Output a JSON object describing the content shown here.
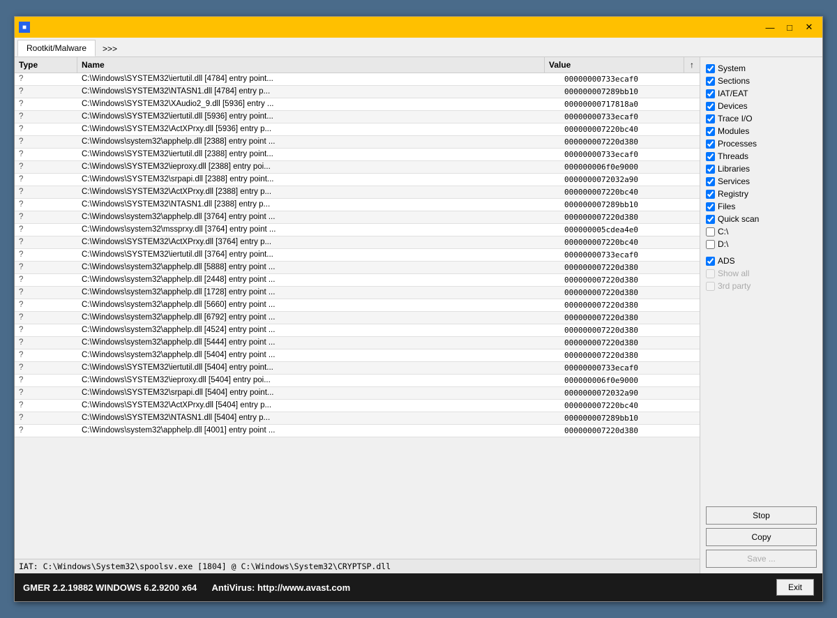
{
  "window": {
    "icon": "■",
    "minimize": "—",
    "maximize": "□",
    "close": "✕"
  },
  "tabs": [
    {
      "label": "Rootkit/Malware",
      "active": true
    },
    {
      "label": ">>>",
      "active": false
    }
  ],
  "table": {
    "columns": [
      {
        "label": "Type",
        "key": "type"
      },
      {
        "label": "Name",
        "key": "name"
      },
      {
        "label": "Value",
        "key": "value"
      },
      {
        "label": "↑",
        "key": "sort"
      }
    ],
    "rows": [
      {
        "type": "?",
        "name": "C:\\Windows\\SYSTEM32\\iertutil.dll [4784] entry point...",
        "value": "00000000733ecaf0"
      },
      {
        "type": "?",
        "name": "C:\\Windows\\SYSTEM32\\NTASN1.dll [4784] entry p...",
        "value": "000000007289bb10"
      },
      {
        "type": "?",
        "name": "C:\\Windows\\SYSTEM32\\XAudio2_9.dll [5936] entry ...",
        "value": "00000000717818a0"
      },
      {
        "type": "?",
        "name": "C:\\Windows\\SYSTEM32\\iertutil.dll [5936] entry point...",
        "value": "00000000733ecaf0"
      },
      {
        "type": "?",
        "name": "C:\\Windows\\SYSTEM32\\ActXPrxy.dll [5936] entry p...",
        "value": "000000007220bc40"
      },
      {
        "type": "?",
        "name": "C:\\Windows\\system32\\apphelp.dll [2388] entry point ...",
        "value": "000000007220d380"
      },
      {
        "type": "?",
        "name": "C:\\Windows\\SYSTEM32\\iertutil.dll [2388] entry point...",
        "value": "00000000733ecaf0"
      },
      {
        "type": "?",
        "name": "C:\\Windows\\SYSTEM32\\ieproxy.dll [2388] entry poi...",
        "value": "000000006f0e9000"
      },
      {
        "type": "?",
        "name": "C:\\Windows\\SYSTEM32\\srpapi.dll [2388] entry point...",
        "value": "0000000072032a90"
      },
      {
        "type": "?",
        "name": "C:\\Windows\\SYSTEM32\\ActXPrxy.dll [2388] entry p...",
        "value": "000000007220bc40"
      },
      {
        "type": "?",
        "name": "C:\\Windows\\SYSTEM32\\NTASN1.dll [2388] entry p...",
        "value": "000000007289bb10"
      },
      {
        "type": "?",
        "name": "C:\\Windows\\system32\\apphelp.dll [3764] entry point ...",
        "value": "000000007220d380"
      },
      {
        "type": "?",
        "name": "C:\\Windows\\system32\\mssprxy.dll [3764] entry point ...",
        "value": "000000005cdea4e0"
      },
      {
        "type": "?",
        "name": "C:\\Windows\\SYSTEM32\\ActXPrxy.dll [3764] entry p...",
        "value": "000000007220bc40"
      },
      {
        "type": "?",
        "name": "C:\\Windows\\SYSTEM32\\iertutil.dll [3764] entry point...",
        "value": "00000000733ecaf0"
      },
      {
        "type": "?",
        "name": "C:\\Windows\\system32\\apphelp.dll [5888] entry point ...",
        "value": "000000007220d380"
      },
      {
        "type": "?",
        "name": "C:\\Windows\\system32\\apphelp.dll [2448] entry point ...",
        "value": "000000007220d380"
      },
      {
        "type": "?",
        "name": "C:\\Windows\\system32\\apphelp.dll [1728] entry point ...",
        "value": "000000007220d380"
      },
      {
        "type": "?",
        "name": "C:\\Windows\\system32\\apphelp.dll [5660] entry point ...",
        "value": "000000007220d380"
      },
      {
        "type": "?",
        "name": "C:\\Windows\\system32\\apphelp.dll [6792] entry point ...",
        "value": "000000007220d380"
      },
      {
        "type": "?",
        "name": "C:\\Windows\\system32\\apphelp.dll [4524] entry point ...",
        "value": "000000007220d380"
      },
      {
        "type": "?",
        "name": "C:\\Windows\\system32\\apphelp.dll [5444] entry point ...",
        "value": "000000007220d380"
      },
      {
        "type": "?",
        "name": "C:\\Windows\\system32\\apphelp.dll [5404] entry point ...",
        "value": "000000007220d380"
      },
      {
        "type": "?",
        "name": "C:\\Windows\\SYSTEM32\\iertutil.dll [5404] entry point...",
        "value": "00000000733ecaf0"
      },
      {
        "type": "?",
        "name": "C:\\Windows\\SYSTEM32\\ieproxy.dll [5404] entry poi...",
        "value": "000000006f0e9000"
      },
      {
        "type": "?",
        "name": "C:\\Windows\\SYSTEM32\\srpapi.dll [5404] entry point...",
        "value": "0000000072032a90"
      },
      {
        "type": "?",
        "name": "C:\\Windows\\SYSTEM32\\ActXPrxy.dll [5404] entry p...",
        "value": "000000007220bc40"
      },
      {
        "type": "?",
        "name": "C:\\Windows\\SYSTEM32\\NTASN1.dll [5404] entry p...",
        "value": "000000007289bb10"
      },
      {
        "type": "?",
        "name": "C:\\Windows\\system32\\apphelp.dll [4001] entry point ...",
        "value": "000000007220d380"
      }
    ]
  },
  "status_bar": {
    "text": "IAT: C:\\Windows\\System32\\spoolsv.exe [1804] @ C:\\Windows\\System32\\CRYPTSP.dll"
  },
  "sidebar": {
    "items": [
      {
        "label": "System",
        "checked": true,
        "name": "cb-system"
      },
      {
        "label": "Sections",
        "checked": true,
        "name": "cb-sections"
      },
      {
        "label": "IAT/EAT",
        "checked": true,
        "name": "cb-iateat"
      },
      {
        "label": "Devices",
        "checked": true,
        "name": "cb-devices"
      },
      {
        "label": "Trace I/O",
        "checked": true,
        "name": "cb-traceio"
      },
      {
        "label": "Modules",
        "checked": true,
        "name": "cb-modules"
      },
      {
        "label": "Processes",
        "checked": true,
        "name": "cb-processes"
      },
      {
        "label": "Threads",
        "checked": true,
        "name": "cb-threads"
      },
      {
        "label": "Libraries",
        "checked": true,
        "name": "cb-libraries"
      },
      {
        "label": "Services",
        "checked": true,
        "name": "cb-services"
      },
      {
        "label": "Registry",
        "checked": true,
        "name": "cb-registry"
      },
      {
        "label": "Files",
        "checked": true,
        "name": "cb-files"
      },
      {
        "label": "Quick scan",
        "checked": true,
        "name": "cb-quickscan"
      },
      {
        "label": "C:\\",
        "checked": false,
        "name": "cb-cdrive"
      },
      {
        "label": "D:\\",
        "checked": false,
        "name": "cb-ddrive"
      },
      {
        "label": "ADS",
        "checked": true,
        "name": "cb-ads"
      },
      {
        "label": "Show all",
        "checked": false,
        "name": "cb-showall",
        "disabled": true
      },
      {
        "label": "3rd party",
        "checked": false,
        "name": "cb-3rdparty",
        "disabled": true
      }
    ],
    "buttons": {
      "stop": "Stop",
      "copy": "Copy",
      "save": "Save ..."
    }
  },
  "bottom_bar": {
    "info": "GMER 2.2.19882    WINDOWS 6.2.9200  x64",
    "antivirus": "AntiVirus: http://www.avast.com",
    "exit_label": "Exit"
  }
}
